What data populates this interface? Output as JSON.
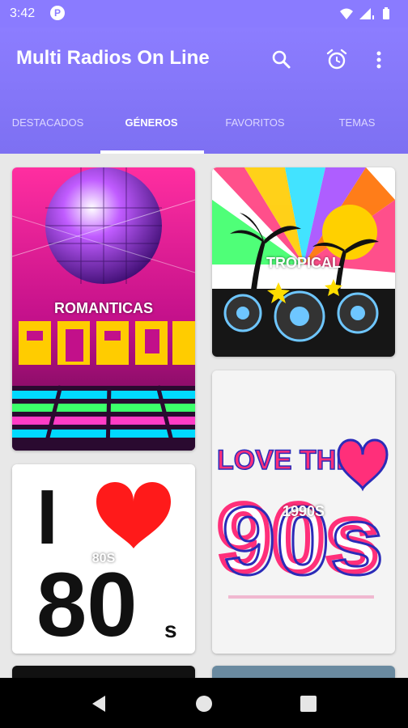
{
  "status": {
    "time": "3:42",
    "app_badge": "P",
    "icons": [
      "wifi-icon",
      "signal-icon",
      "battery-icon"
    ]
  },
  "appbar": {
    "title": "Multi Radios On Line",
    "actions": [
      "search-icon",
      "alarm-icon",
      "more-vert-icon"
    ]
  },
  "tabs": [
    {
      "label": "DESTACADOS",
      "active": false
    },
    {
      "label": "GÉNEROS",
      "active": true
    },
    {
      "label": "FAVORITOS",
      "active": false
    },
    {
      "label": "TEMAS",
      "active": false
    }
  ],
  "cards": [
    {
      "label": "ROMANTICAS",
      "art_text": "BALADA"
    },
    {
      "label": "TROPICAL"
    },
    {
      "label": "1990S",
      "art_text_line1": "LOVE THE",
      "art_text_line2": "90s"
    },
    {
      "label": "80S",
      "art_text_line1": "I",
      "art_text_line2": "80",
      "art_text_suffix": "s"
    }
  ],
  "navbar": {
    "icons": [
      "back-icon",
      "home-icon",
      "recents-icon"
    ]
  },
  "colors": {
    "primary": "#8a7bff",
    "tab_indicator": "#ffffff",
    "background": "#e8e8e8"
  }
}
